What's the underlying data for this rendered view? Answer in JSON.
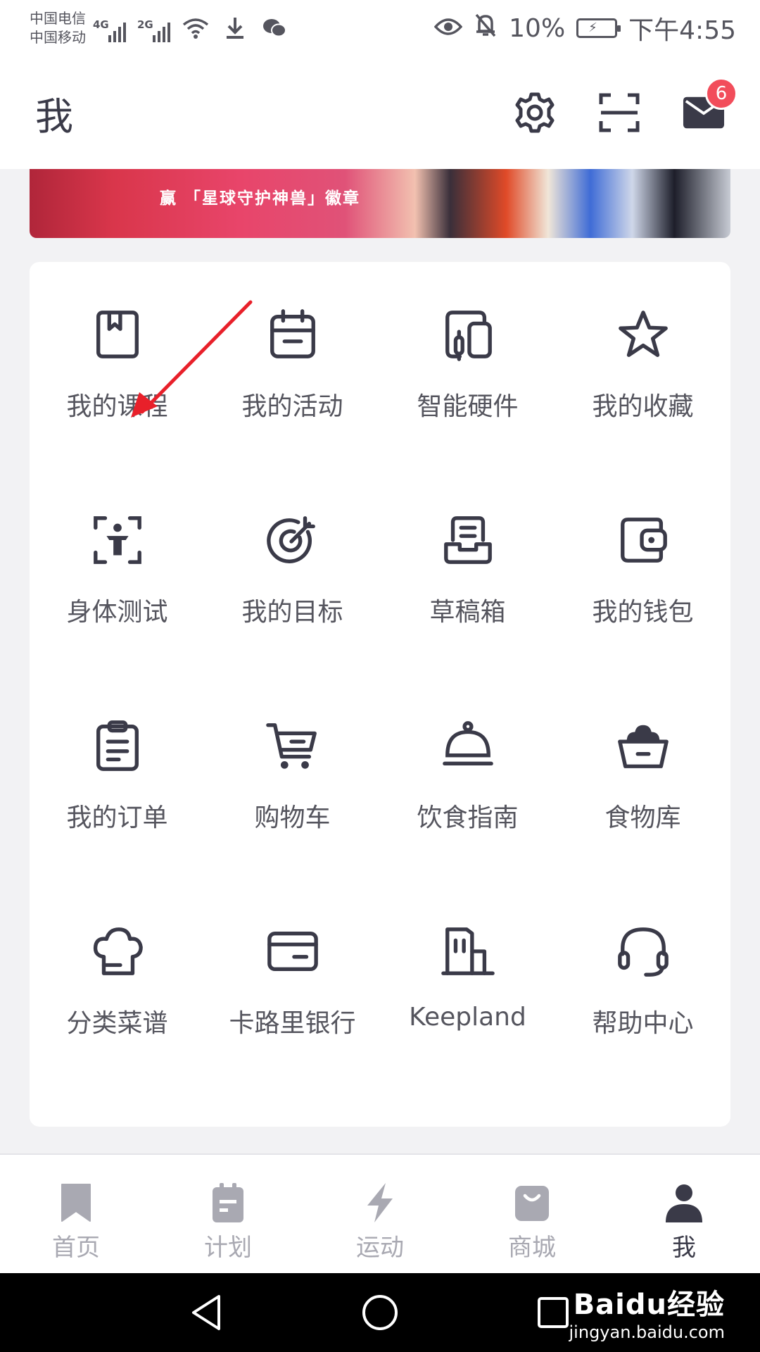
{
  "status_bar": {
    "carrier_1": "中国电信",
    "carrier_2": "中国移动",
    "net_1": "4G",
    "net_2": "2G",
    "battery": "10%",
    "time": "下午4:55"
  },
  "header": {
    "title": "我",
    "mail_badge_count": "6"
  },
  "banner": {
    "text": "赢 「星球守护神兽」徽章"
  },
  "grid": {
    "items": [
      {
        "label": "我的课程",
        "icon": "book-icon"
      },
      {
        "label": "我的活动",
        "icon": "calendar-icon"
      },
      {
        "label": "智能硬件",
        "icon": "devices-icon"
      },
      {
        "label": "我的收藏",
        "icon": "star-icon"
      },
      {
        "label": "身体测试",
        "icon": "body-scan-icon"
      },
      {
        "label": "我的目标",
        "icon": "target-icon"
      },
      {
        "label": "草稿箱",
        "icon": "drafts-icon"
      },
      {
        "label": "我的钱包",
        "icon": "wallet-icon"
      },
      {
        "label": "我的订单",
        "icon": "clipboard-icon"
      },
      {
        "label": "购物车",
        "icon": "cart-icon"
      },
      {
        "label": "饮食指南",
        "icon": "cloche-icon"
      },
      {
        "label": "食物库",
        "icon": "food-basket-icon"
      },
      {
        "label": "分类菜谱",
        "icon": "chef-hat-icon"
      },
      {
        "label": "卡路里银行",
        "icon": "card-icon"
      },
      {
        "label": "Keepland",
        "icon": "building-icon"
      },
      {
        "label": "帮助中心",
        "icon": "headset-icon"
      }
    ]
  },
  "tabs": [
    {
      "label": "首页",
      "icon": "bookmark-icon",
      "active": false
    },
    {
      "label": "计划",
      "icon": "plan-icon",
      "active": false
    },
    {
      "label": "运动",
      "icon": "lightning-icon",
      "active": false
    },
    {
      "label": "商城",
      "icon": "shopping-bag-icon",
      "active": false
    },
    {
      "label": "我",
      "icon": "person-icon",
      "active": true
    }
  ],
  "watermark": {
    "brand": "Baidu经验",
    "url": "jingyan.baidu.com"
  },
  "colors": {
    "icon": "#3a3a48",
    "label": "#55555e",
    "tab_inactive": "#a9a9b2",
    "badge": "#f24d5b",
    "arrow": "#e8202a",
    "background": "#f2f2f4"
  }
}
